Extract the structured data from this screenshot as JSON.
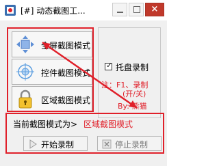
{
  "window": {
    "title": "[#]  动态截图工..."
  },
  "modes": [
    {
      "label": "全屏截图模式",
      "icon": "fullscreen-arrows-icon"
    },
    {
      "label": "控件截图模式",
      "icon": "crosshair-target-icon"
    },
    {
      "label": "区域截图模式",
      "icon": "padlock-icon"
    }
  ],
  "options": {
    "tray_record_label": "托盘录制",
    "tray_record_checked": true,
    "hint_line1": "注：F1、录制",
    "hint_line2": "(开/关)",
    "author": "By: 熊猫"
  },
  "status": {
    "label": "当前截图模式为>",
    "value": "区域截图模式"
  },
  "buttons": {
    "start": "开始录制",
    "stop": "停止录制"
  },
  "colors": {
    "accent_red": "#e0202a"
  }
}
